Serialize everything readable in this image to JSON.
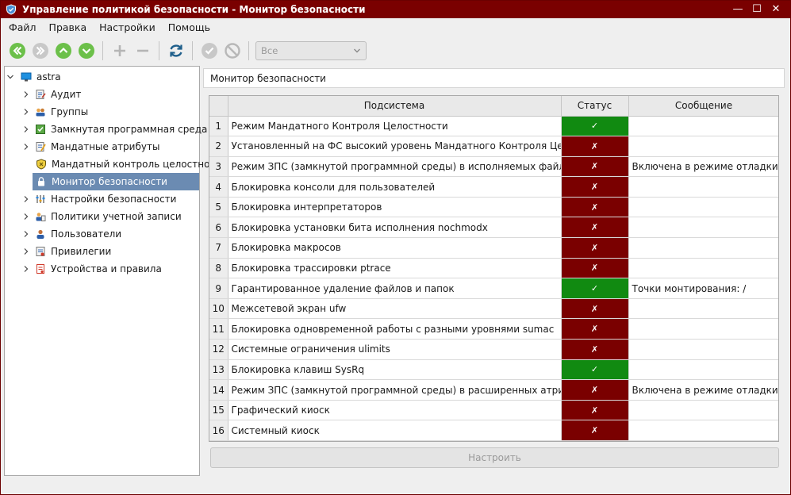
{
  "window": {
    "title": "Управление политикой безопасности - Монитор безопасности"
  },
  "menu": [
    "Файл",
    "Правка",
    "Настройки",
    "Помощь"
  ],
  "toolbar": {
    "filter_value": "Все"
  },
  "tree": {
    "root": "astra",
    "items": [
      {
        "label": "Аудит",
        "icon": "audit-icon"
      },
      {
        "label": "Группы",
        "icon": "groups-icon"
      },
      {
        "label": "Замкнутая программная среда",
        "icon": "closed-env-icon"
      },
      {
        "label": "Мандатные атрибуты",
        "icon": "mandatory-attrs-icon"
      },
      {
        "label": "Мандатный контроль целостности",
        "icon": "integrity-icon"
      },
      {
        "label": "Монитор безопасности",
        "icon": "lock-icon"
      },
      {
        "label": "Настройки безопасности",
        "icon": "security-settings-icon"
      },
      {
        "label": "Политики учетной записи",
        "icon": "account-policy-icon"
      },
      {
        "label": "Пользователи",
        "icon": "users-icon"
      },
      {
        "label": "Привилегии",
        "icon": "privileges-icon"
      },
      {
        "label": "Устройства и правила",
        "icon": "devices-icon"
      }
    ]
  },
  "main": {
    "heading": "Монитор безопасности",
    "columns": [
      "Подсистема",
      "Статус",
      "Сообщение"
    ],
    "rows": [
      {
        "n": "1",
        "subsystem": "Режим Мандатного Контроля Целостности",
        "status": "✓",
        "state": "ok",
        "message": ""
      },
      {
        "n": "2",
        "subsystem": "Установленный на ФС высокий уровень Мандатного Контроля Целостности",
        "status": "✗",
        "state": "bad",
        "message": ""
      },
      {
        "n": "3",
        "subsystem": "Режим ЗПС (замкнутой программной среды) в исполняемых файлах",
        "status": "✗",
        "state": "bad",
        "message": "Включена в режиме отладки"
      },
      {
        "n": "4",
        "subsystem": "Блокировка консоли для пользователей",
        "status": "✗",
        "state": "bad",
        "message": ""
      },
      {
        "n": "5",
        "subsystem": "Блокировка интерпретаторов",
        "status": "✗",
        "state": "bad",
        "message": ""
      },
      {
        "n": "6",
        "subsystem": "Блокировка установки бита исполнения nochmodx",
        "status": "✗",
        "state": "bad",
        "message": ""
      },
      {
        "n": "7",
        "subsystem": "Блокировка макросов",
        "status": "✗",
        "state": "bad",
        "message": ""
      },
      {
        "n": "8",
        "subsystem": "Блокировка трассировки ptrace",
        "status": "✗",
        "state": "bad",
        "message": ""
      },
      {
        "n": "9",
        "subsystem": "Гарантированное удаление файлов и папок",
        "status": "✓",
        "state": "ok",
        "message": "Точки монтирования: /"
      },
      {
        "n": "10",
        "subsystem": "Межсетевой экран ufw",
        "status": "✗",
        "state": "bad",
        "message": ""
      },
      {
        "n": "11",
        "subsystem": "Блокировка одновременной работы с разными уровнями sumac",
        "status": "✗",
        "state": "bad",
        "message": ""
      },
      {
        "n": "12",
        "subsystem": "Системные ограничения ulimits",
        "status": "✗",
        "state": "bad",
        "message": ""
      },
      {
        "n": "13",
        "subsystem": "Блокировка клавиш SysRq",
        "status": "✓",
        "state": "ok",
        "message": ""
      },
      {
        "n": "14",
        "subsystem": "Режим ЗПС (замкнутой программной среды) в расширенных атрибутах",
        "status": "✗",
        "state": "bad",
        "message": "Включена в режиме отладки"
      },
      {
        "n": "15",
        "subsystem": "Графический киоск",
        "status": "✗",
        "state": "bad",
        "message": ""
      },
      {
        "n": "16",
        "subsystem": "Системный киоск",
        "status": "✗",
        "state": "bad",
        "message": ""
      }
    ],
    "configure_label": "Настроить"
  },
  "colors": {
    "titlebar": "#7a0000",
    "ok": "#118a11",
    "bad": "#7a0000",
    "selection": "#6b8bb2"
  }
}
